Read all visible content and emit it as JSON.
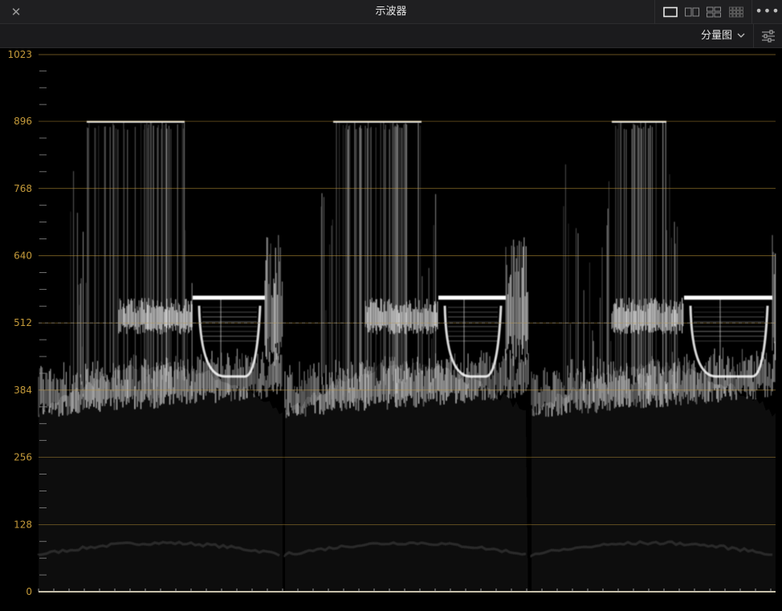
{
  "window": {
    "title": "示波器",
    "close_glyph": "✕",
    "more_glyph": "•••",
    "layout_icons": [
      "single-view-icon",
      "dual-view-icon",
      "quad-view-icon",
      "eight-view-icon"
    ]
  },
  "toolbar": {
    "mode_label": "分量图",
    "settings_icon": "sliders-icon"
  },
  "scope": {
    "scale_labels": [
      "1023",
      "896",
      "768",
      "640",
      "512",
      "384",
      "256",
      "128",
      "0"
    ],
    "scale_color": "#c49a3a",
    "panels": [
      "red-channel-parade",
      "green-channel-parade",
      "blue-channel-parade"
    ]
  }
}
